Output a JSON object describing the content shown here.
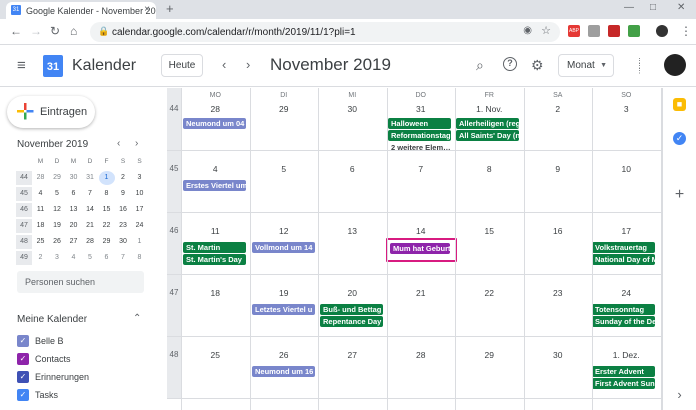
{
  "browser": {
    "tab_title": "Google Kalender - November 20",
    "tab_favicon": "31",
    "tab_close": "×",
    "new_tab": "+",
    "url": "calendar.google.com/calendar/r/month/2019/11/1?pli=1",
    "back_icon": "←",
    "forward_icon": "→",
    "reload_icon": "↻",
    "home_icon": "⌂",
    "lock_icon": "🔒",
    "star_icon": "☆",
    "eye_icon": "◉",
    "ext_abp": "ABP",
    "minimize_icon": "—",
    "maximize_icon": "□",
    "close_icon": "✕",
    "menu_icon": "⋮"
  },
  "header": {
    "menu_icon": "≡",
    "logo_text": "31",
    "app_title": "Kalender",
    "today_label": "Heute",
    "prev_icon": "‹",
    "next_icon": "›",
    "month_title": "November 2019",
    "search_icon": "⌕",
    "help_icon": "?",
    "settings_icon": "⚙",
    "view_label": "Monat",
    "view_caret": "▼",
    "apps_icon": "⋮⋮⋮"
  },
  "sidebar": {
    "create_label": "Eintragen",
    "mini_title": "November 2019",
    "mini_prev": "‹",
    "mini_next": "›",
    "mini_headers": [
      "M",
      "D",
      "M",
      "D",
      "F",
      "S",
      "S"
    ],
    "mini_weeks": [
      {
        "wk": "44",
        "days": [
          "28",
          "29",
          "30",
          "31",
          "1",
          "2",
          "3"
        ]
      },
      {
        "wk": "45",
        "days": [
          "4",
          "5",
          "6",
          "7",
          "8",
          "9",
          "10"
        ]
      },
      {
        "wk": "46",
        "days": [
          "11",
          "12",
          "13",
          "14",
          "15",
          "16",
          "17"
        ]
      },
      {
        "wk": "47",
        "days": [
          "18",
          "19",
          "20",
          "21",
          "22",
          "23",
          "24"
        ]
      },
      {
        "wk": "48",
        "days": [
          "25",
          "26",
          "27",
          "28",
          "29",
          "30",
          "1"
        ]
      },
      {
        "wk": "49",
        "days": [
          "2",
          "3",
          "4",
          "5",
          "6",
          "7",
          "8"
        ]
      }
    ],
    "people_search_placeholder": "Personen suchen",
    "my_calendars_title": "Meine Kalender",
    "my_calendars_chevron": "⌃",
    "calendars": [
      {
        "label": "Belle B",
        "color": "#7986cb"
      },
      {
        "label": "Contacts",
        "color": "#8e24aa"
      },
      {
        "label": "Erinnerungen",
        "color": "#3f51b5"
      },
      {
        "label": "Tasks",
        "color": "#4285f4"
      }
    ]
  },
  "calendar": {
    "day_headers": [
      "MO",
      "DI",
      "MI",
      "DO",
      "FR",
      "SA",
      "SO"
    ],
    "weeks": [
      {
        "wk": "44",
        "days": [
          "28",
          "29",
          "30",
          "31",
          "1. Nov.",
          "2",
          "3"
        ]
      },
      {
        "wk": "45",
        "days": [
          "4",
          "5",
          "6",
          "7",
          "8",
          "9",
          "10"
        ]
      },
      {
        "wk": "46",
        "days": [
          "11",
          "12",
          "13",
          "14",
          "15",
          "16",
          "17"
        ]
      },
      {
        "wk": "47",
        "days": [
          "18",
          "19",
          "20",
          "21",
          "22",
          "23",
          "24"
        ]
      },
      {
        "wk": "48",
        "days": [
          "25",
          "26",
          "27",
          "28",
          "29",
          "30",
          "1. Dez."
        ]
      }
    ],
    "events": {
      "w0_mo": "Neumond um 04",
      "w0_do_1": "Halloween",
      "w0_do_2": "Reformationstag",
      "w0_do_more": "2 weitere Elem…",
      "w0_fr_1": "Allerheiligen (reg",
      "w0_fr_2": "All Saints' Day (n",
      "w1_mo": "Erstes Viertel um",
      "w2_mo_1": "St. Martin",
      "w2_mo_2": "St. Martin's Day",
      "w2_di": "Vollmond um 14",
      "w2_do": "Mum hat Geburt",
      "w2_so_1": "Volkstrauertag",
      "w2_so_2": "National Day of M",
      "w3_di": "Letztes Viertel u",
      "w3_mi_1": "Buß- und Bettag",
      "w3_mi_2": "Repentance Day",
      "w3_so_1": "Totensonntag",
      "w3_so_2": "Sunday of the De",
      "w4_di": "Neumond um 16",
      "w4_so_1": "Erster Advent",
      "w4_so_2": "First Advent Sun"
    }
  },
  "right_panel": {
    "keep_icon": "■",
    "tasks_icon": "✓",
    "add_icon": "+",
    "expand_icon": "›"
  }
}
